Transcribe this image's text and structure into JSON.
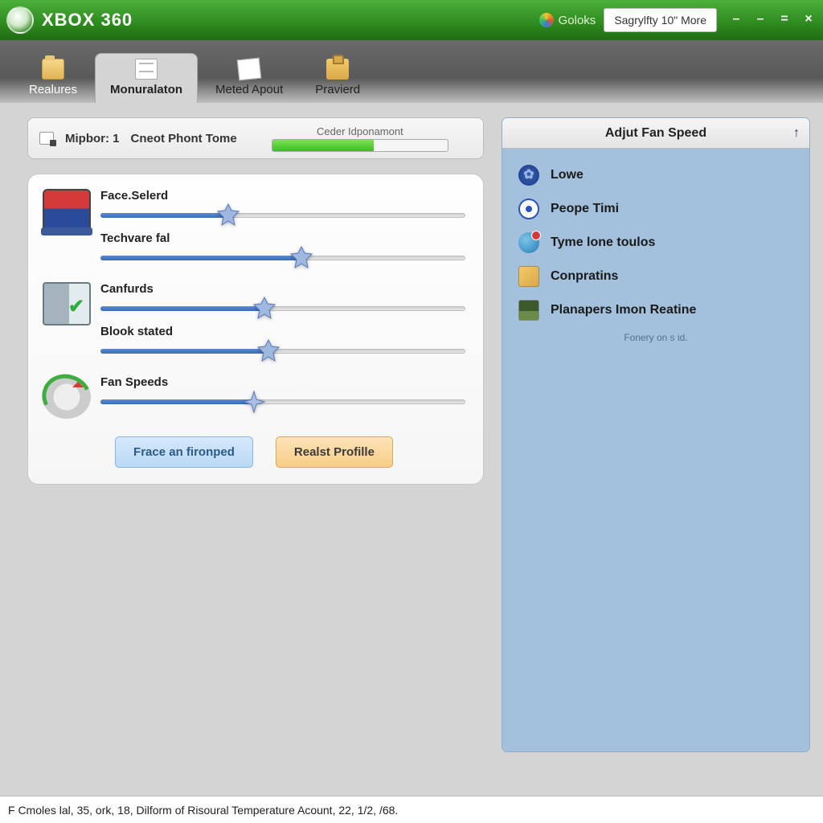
{
  "titlebar": {
    "brand": "XBOX 360",
    "goloks": "Goloks",
    "pill": "Sagrylfty 10\" More"
  },
  "tabs": [
    {
      "label": "Realures",
      "icon": "folder"
    },
    {
      "label": "Monuralaton",
      "icon": "doc"
    },
    {
      "label": "Meted Apout",
      "icon": "note"
    },
    {
      "label": "Pravierd",
      "icon": "clip"
    }
  ],
  "status": {
    "mip_label": "Mipbor:",
    "mip_value": "1",
    "phont": "Cneot Phont Tome",
    "progress_label": "Ceder Idponamont",
    "progress_pct": 58
  },
  "sliders": [
    {
      "label": "Face.Selerd",
      "pct": 35,
      "icon": "console"
    },
    {
      "label": "Techvare fal",
      "pct": 55,
      "icon": ""
    },
    {
      "label": "Canfurds",
      "pct": 45,
      "icon": "server"
    },
    {
      "label": "Blook stated",
      "pct": 46,
      "icon": ""
    },
    {
      "label": "Fan Speeds",
      "pct": 42,
      "icon": "refresh"
    }
  ],
  "buttons": {
    "left": "Frace an fironped",
    "right": "Realst Profille"
  },
  "panel": {
    "title": "Adjut Fan Speed",
    "items": [
      {
        "label": "Lowe",
        "icon": "gear"
      },
      {
        "label": "Peope Timi",
        "icon": "ribbon"
      },
      {
        "label": "Tyme lone toulos",
        "icon": "globe"
      },
      {
        "label": "Conpratins",
        "icon": "thumb"
      },
      {
        "label": "Planapers Imon Reatine",
        "icon": "photo"
      }
    ],
    "footer": "Fonery on s id."
  },
  "bottombar": "F Cmoles lal, 35, ork, 18, Dilform of Risoural Temperature Acount, 22, 1/2, /68."
}
